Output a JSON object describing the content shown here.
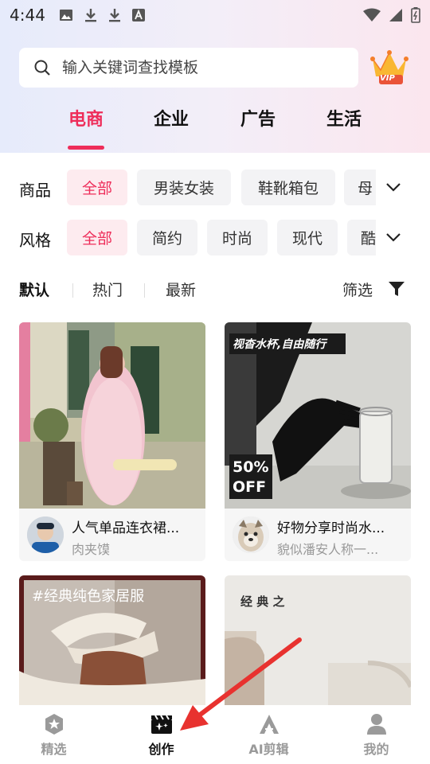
{
  "status_bar": {
    "time": "4:44"
  },
  "search": {
    "placeholder": "输入关键词查找模板"
  },
  "vip": {
    "label": "VIP"
  },
  "main_tabs": [
    {
      "label": "电商",
      "active": true
    },
    {
      "label": "企业",
      "active": false
    },
    {
      "label": "广告",
      "active": false
    },
    {
      "label": "生活",
      "active": false
    }
  ],
  "filters": {
    "product": {
      "label": "商品",
      "chips": [
        "全部",
        "男装女装",
        "鞋靴箱包",
        "母"
      ],
      "selected": "全部"
    },
    "style": {
      "label": "风格",
      "chips": [
        "全部",
        "简约",
        "时尚",
        "现代",
        "酷"
      ],
      "selected": "全部"
    }
  },
  "sort": {
    "items": [
      "默认",
      "热门",
      "最新"
    ],
    "selected": "默认",
    "filter_label": "筛选"
  },
  "cards": [
    {
      "title": "人气单品连衣裙...",
      "author": "肉夹馍",
      "overlay": ""
    },
    {
      "title": "好物分享时尚水...",
      "author": "貌似潘安人称一...",
      "overlay": "视杳水杯,自由随行",
      "badge_pct": "50%",
      "badge_off": "OFF"
    },
    {
      "title": "",
      "author": "",
      "overlay": "#经典纯色家居服"
    },
    {
      "title": "",
      "author": "",
      "overlay": "经 典 之"
    }
  ],
  "bottom_nav": [
    {
      "label": "精选",
      "active": false
    },
    {
      "label": "创作",
      "active": true
    },
    {
      "label": "AI剪辑",
      "active": false
    },
    {
      "label": "我的",
      "active": false
    }
  ],
  "colors": {
    "accent": "#ee2d5a"
  }
}
